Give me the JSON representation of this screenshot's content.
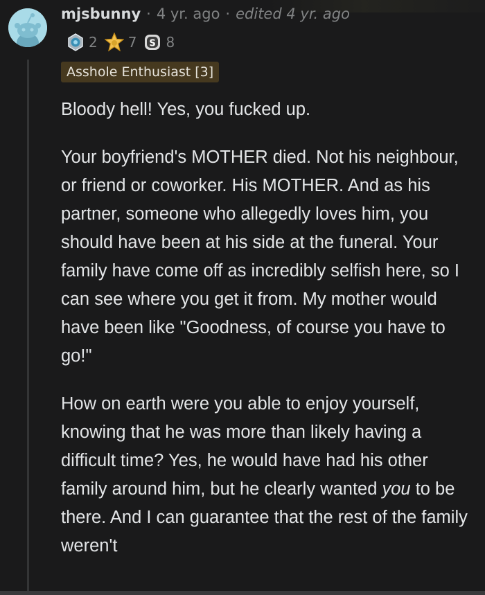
{
  "comment": {
    "username": "mjsbunny",
    "age": "4 yr. ago",
    "edited": "edited 4 yr. ago",
    "awards": [
      {
        "icon": "silver-medal-icon",
        "count": "2"
      },
      {
        "icon": "gold-star-icon",
        "count": "7"
      },
      {
        "icon": "s-badge-icon",
        "count": "8"
      }
    ],
    "flair": "Asshole Enthusiast [3]",
    "paragraphs": {
      "p1": "Bloody hell! Yes, you fucked up.",
      "p2": "Your boyfriend's MOTHER died. Not his neighbour, or friend or coworker. His MOTHER. And as his partner, someone who allegedly loves him, you should have been at his side at the funeral. Your family have come off as incredibly selfish here, so I can see where you get it from. My mother would have been like \"Goodness, of course you have to go!\"",
      "p3_before": "How on earth were you able to enjoy yourself, knowing that he was more than likely having a difficult time? Yes, he would have had his other family around him, but he clearly wanted ",
      "p3_em": "you",
      "p3_after": " to be there. And I can guarantee that the rest of the family weren't"
    }
  },
  "colors": {
    "background": "#1a1a1b",
    "text": "#d7dadc",
    "meta": "#818384",
    "flair_bg": "#46391f",
    "avatar_bg": "#a9dbe8"
  }
}
